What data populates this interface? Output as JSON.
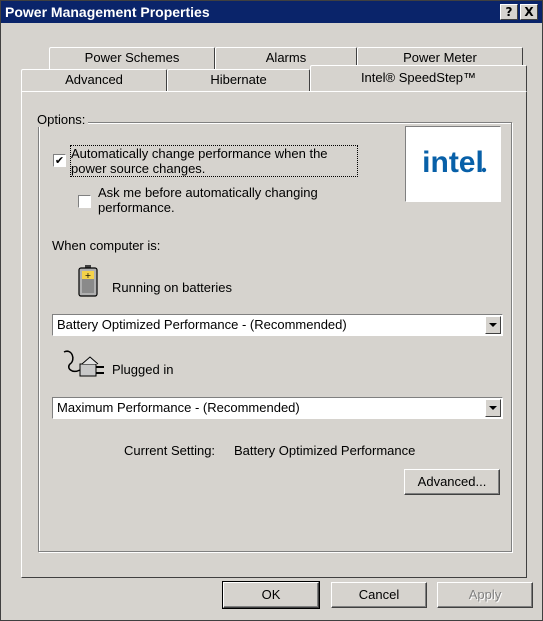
{
  "window": {
    "title": "Power Management Properties",
    "help_button": "?",
    "close_button": "X"
  },
  "tabs": {
    "row1": [
      "Power Schemes",
      "Alarms",
      "Power Meter"
    ],
    "row2": [
      "Advanced",
      "Hibernate",
      "Intel® SpeedStep™"
    ],
    "active": "Intel® SpeedStep™"
  },
  "options": {
    "group_label": "Options:",
    "auto_change": {
      "label_line1": "Automatically change performance when the",
      "label_line2": "power source changes.",
      "checked": true,
      "mark": "✔"
    },
    "ask_before": {
      "label_line1": "Ask me before automatically changing",
      "label_line2": "performance.",
      "checked": false
    },
    "logo_text": "intel"
  },
  "when_computer": {
    "label": "When computer is:",
    "batteries": {
      "label": "Running on batteries",
      "selected": "Battery Optimized Performance - (Recommended)"
    },
    "plugged": {
      "label": "Plugged in",
      "selected": "Maximum Performance - (Recommended)"
    },
    "current_setting_label": "Current Setting:",
    "current_setting_value": "Battery Optimized Performance",
    "advanced_button": "Advanced..."
  },
  "footer": {
    "ok": "OK",
    "cancel": "Cancel",
    "apply": "Apply"
  },
  "colors": {
    "titlebar": "#0a246a",
    "face": "#d6d3ce",
    "intel_blue": "#0860a8"
  }
}
